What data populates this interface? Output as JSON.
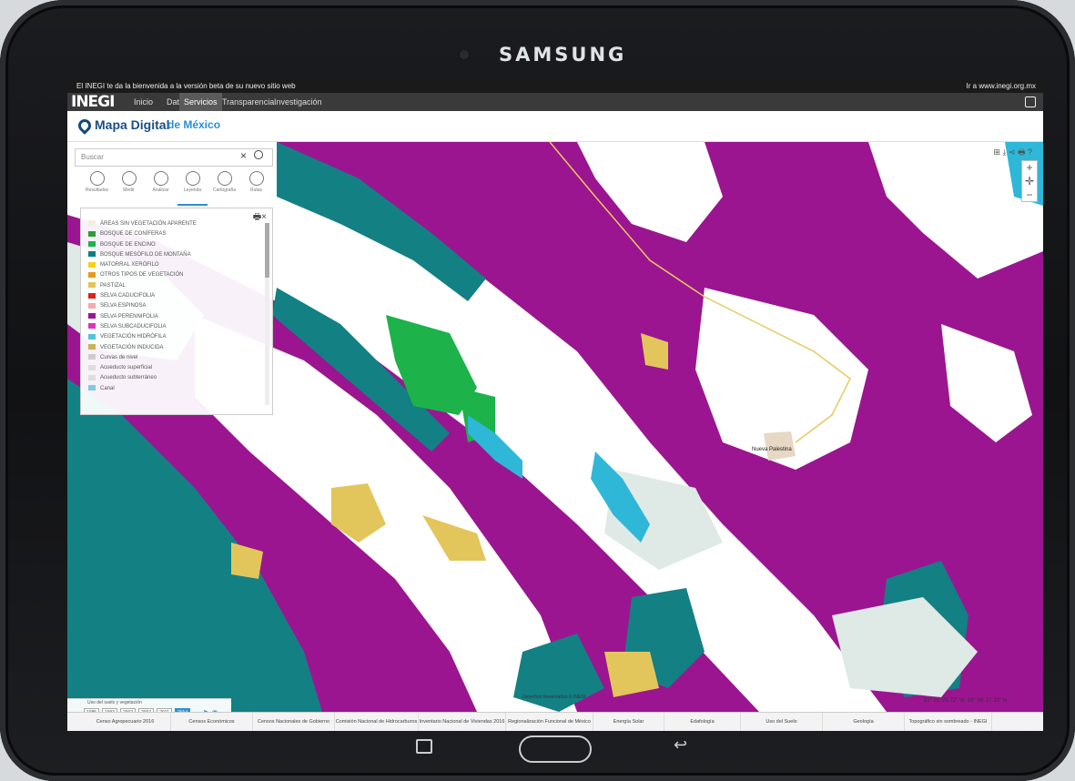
{
  "device": {
    "brand": "SAMSUNG"
  },
  "topbar": {
    "welcome": "El INEGI te da la bienvenida a la versión beta de su nuevo sitio web",
    "right_link": "Ir a www.inegi.org.mx"
  },
  "nav": {
    "logo": "INEGI",
    "items": [
      "Inicio",
      "Datos",
      "Servicios",
      "Transparencia",
      "Investigación"
    ],
    "active": "Servicios"
  },
  "app": {
    "title_main": "Mapa Digital",
    "title_sub": "de México"
  },
  "search": {
    "placeholder": "Buscar"
  },
  "tools": [
    {
      "label": "Resultados",
      "icon": "search-icon"
    },
    {
      "label": "Medir",
      "icon": "ruler-icon"
    },
    {
      "label": "Analizar",
      "icon": "analyze-icon"
    },
    {
      "label": "Leyenda",
      "icon": "legend-icon",
      "active": true
    },
    {
      "label": "Cartografía",
      "icon": "globe-icon"
    },
    {
      "label": "Rutas",
      "icon": "route-icon"
    }
  ],
  "legend": [
    {
      "label": "ÁREAS SIN VEGETACIÓN APARENTE",
      "color": "#f1eee0"
    },
    {
      "label": "BOSQUE DE CONÍFERAS",
      "color": "#2d9a3b"
    },
    {
      "label": "BOSQUE DE ENCINO",
      "color": "#1db24a"
    },
    {
      "label": "BOSQUE MESÓFILO DE MONTAÑA",
      "color": "#0c7f80"
    },
    {
      "label": "MATORRAL XERÓFILO",
      "color": "#f2d218"
    },
    {
      "label": "OTROS TIPOS DE VEGETACIÓN",
      "color": "#e89a1a"
    },
    {
      "label": "PASTIZAL",
      "color": "#e3c25b"
    },
    {
      "label": "SELVA CADUCIFOLIA",
      "color": "#e0201e"
    },
    {
      "label": "SELVA ESPINOSA",
      "color": "#f4a9b0"
    },
    {
      "label": "SELVA PERENNIFOLIA",
      "color": "#9b1590"
    },
    {
      "label": "SELVA SUBCADUCIFOLIA",
      "color": "#d93ab4"
    },
    {
      "label": "VEGETACIÓN HIDRÓFILA",
      "color": "#53c4d4"
    },
    {
      "label": "VEGETACIÓN INDUCIDA",
      "color": "#c7b35a"
    },
    {
      "label": "Curvas de nivel",
      "color": "#cccccc"
    },
    {
      "label": "Acueducto superficial",
      "color": "#dddddd"
    },
    {
      "label": "Acueducto subterráneo",
      "color": "#dddddd"
    },
    {
      "label": "Canal",
      "color": "#7ec8e8"
    }
  ],
  "map": {
    "place_label": "Nueva Palestina",
    "credits": "Derechos Reservados © INEGI",
    "coords": "91° 21' 29.72\" W, 16° 56' 27.33\" N",
    "colors": {
      "purple": "#9b1590",
      "teal": "#138084",
      "white": "#ffffff",
      "pale": "#dfe9e6",
      "yellow": "#e3c65b",
      "green": "#1db24a",
      "cyan": "#2fb7d8"
    }
  },
  "timeline": {
    "title": "Uso del suelo y vegetación",
    "years": [
      "1985",
      "1993",
      "2002",
      "2007",
      "2011",
      "2014"
    ],
    "selected": "2014"
  },
  "layers": [
    "Censo Agropecuario 2016",
    "Censos Económicos",
    "Censos Nacionales de Gobierno",
    "Comisión Nacional de Hidrocarburos",
    "Inventario Nacional de Viviendas 2016",
    "Regionalización Funcional de México",
    "Energía Solar",
    "Edafología",
    "Uso del Suelo",
    "Geología",
    "Topográfico sin sombreado - INEGI"
  ],
  "maptools_text": "⊞ ⤓ ⋖ 🖶 ?"
}
